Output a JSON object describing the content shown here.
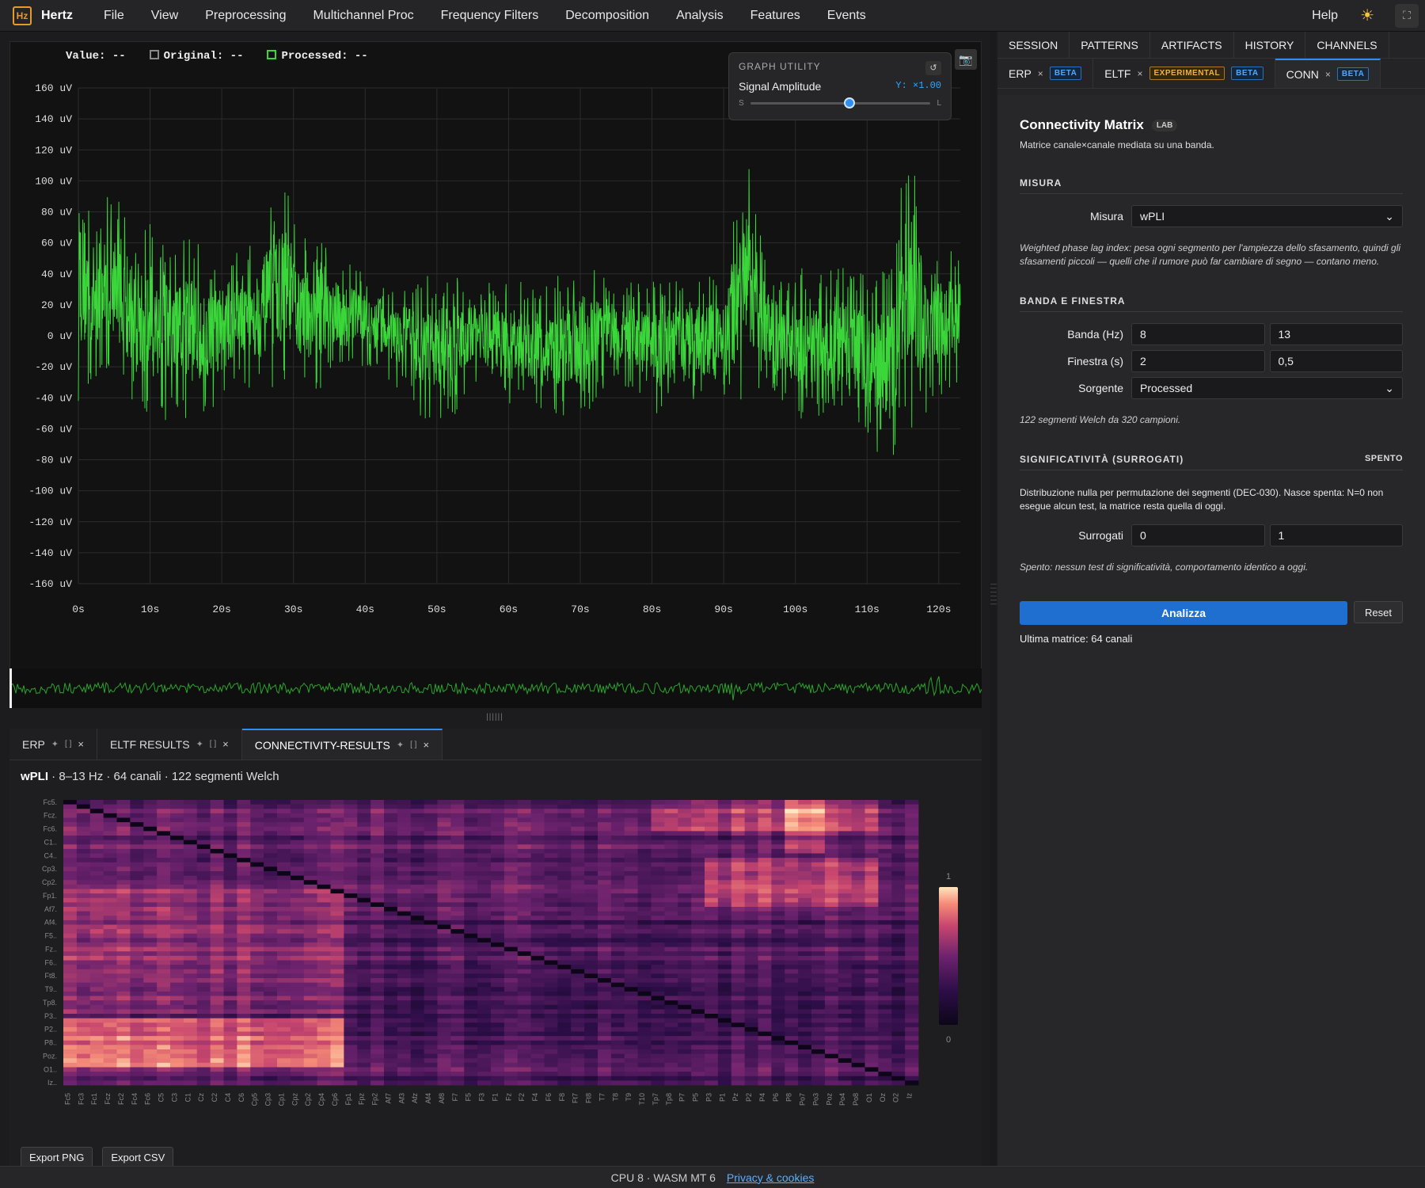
{
  "app": {
    "logo": "Hz",
    "name": "Hertz"
  },
  "menu": [
    "File",
    "View",
    "Preprocessing",
    "Multichannel Proc",
    "Frequency Filters",
    "Decomposition",
    "Analysis",
    "Features",
    "Events"
  ],
  "menu_right": {
    "help": "Help",
    "theme_icon": "sun-icon",
    "fullscreen_icon": "fullscreen-icon"
  },
  "readout": {
    "value_label": "Value:",
    "value": "--",
    "original_label": "Original:",
    "original": "--",
    "processed_label": "Processed:",
    "processed": "--"
  },
  "colors": {
    "signal": "#3ad63a",
    "accent": "#2e8ff0",
    "background": "#121212"
  },
  "graph_utility": {
    "title": "GRAPH UTILITY",
    "reset_icon": "↺",
    "label": "Signal Amplitude",
    "value": "Y: ×1.00",
    "min_label": "S",
    "max_label": "L",
    "slider_fraction": 0.52
  },
  "chart_data": {
    "type": "line",
    "xlabel": "",
    "ylabel": "",
    "xlim": [
      0,
      123
    ],
    "ylim": [
      -160,
      160
    ],
    "x_ticks": [
      "0s",
      "10s",
      "20s",
      "30s",
      "40s",
      "50s",
      "60s",
      "70s",
      "80s",
      "90s",
      "100s",
      "110s",
      "120s"
    ],
    "y_ticks": [
      "160 uV",
      "140 uV",
      "120 uV",
      "100 uV",
      "80 uV",
      "60 uV",
      "40 uV",
      "20 uV",
      "0 uV",
      "-20 uV",
      "-40 uV",
      "-60 uV",
      "-80 uV",
      "-100 uV",
      "-120 uV",
      "-140 uV",
      "-160 uV"
    ],
    "grid": true,
    "series": [
      {
        "values_envelope": [
          [
            0,
            -45,
            130
          ],
          [
            2,
            -35,
            85
          ],
          [
            5,
            -25,
            95
          ],
          [
            8,
            -50,
            60
          ],
          [
            10,
            -60,
            80
          ],
          [
            13,
            -55,
            55
          ],
          [
            15,
            -60,
            70
          ],
          [
            18,
            -50,
            55
          ],
          [
            20,
            -45,
            55
          ],
          [
            23,
            -30,
            60
          ],
          [
            25,
            -40,
            70
          ],
          [
            29,
            -30,
            100
          ],
          [
            31,
            -35,
            60
          ],
          [
            33,
            -40,
            70
          ],
          [
            35,
            -25,
            55
          ],
          [
            40,
            -20,
            40
          ],
          [
            45,
            -35,
            35
          ],
          [
            49,
            -60,
            40
          ],
          [
            52,
            -55,
            40
          ],
          [
            55,
            -30,
            35
          ],
          [
            60,
            -45,
            35
          ],
          [
            65,
            -55,
            35
          ],
          [
            70,
            -55,
            50
          ],
          [
            75,
            -25,
            35
          ],
          [
            80,
            -55,
            35
          ],
          [
            85,
            -40,
            40
          ],
          [
            88,
            -45,
            40
          ],
          [
            90,
            -55,
            45
          ],
          [
            93,
            -40,
            125
          ],
          [
            96,
            -35,
            45
          ],
          [
            100,
            -55,
            45
          ],
          [
            105,
            -50,
            50
          ],
          [
            110,
            -65,
            40
          ],
          [
            113,
            -90,
            45
          ],
          [
            116,
            -60,
            135
          ],
          [
            118,
            -55,
            70
          ],
          [
            120,
            -40,
            60
          ],
          [
            123,
            -30,
            55
          ]
        ]
      }
    ]
  },
  "bottom_tabs": [
    {
      "label": "ERP",
      "pin": "📌",
      "box": "[ ]",
      "close": "×"
    },
    {
      "label": "ELTF RESULTS",
      "pin": "📌",
      "box": "[ ]",
      "close": "×"
    },
    {
      "label": "CONNECTIVITY-RESULTS",
      "pin": "📌",
      "box": "[ ]",
      "close": "×"
    }
  ],
  "heatmap": {
    "title_bold": "wPLI",
    "title_rest": " · 8–13 Hz · 64 canali · 122 segmenti Welch",
    "y_labels": [
      "Fc5.",
      "Fcz.",
      "Fc6.",
      "C1..",
      "C4..",
      "Cp3.",
      "Cp2.",
      "Fp1.",
      "Af7.",
      "Af4.",
      "F5..",
      "Fz..",
      "F6..",
      "Ft8.",
      "T9..",
      "Tp8.",
      "P3..",
      "P2..",
      "P8..",
      "Poz.",
      "O1..",
      "Iz.."
    ],
    "x_labels": [
      "Fc5",
      "Fc3",
      "Fc1",
      "Fcz",
      "Fc2",
      "Fc4",
      "Fc6",
      "C5",
      "C3",
      "C1",
      "Cz",
      "C2",
      "C4",
      "C6",
      "Cp5",
      "Cp3",
      "Cp1",
      "Cpz",
      "Cp2",
      "Cp4",
      "Cp6",
      "Fp1",
      "Fpz",
      "Fp2",
      "Af7",
      "Af3",
      "Afz",
      "Af4",
      "Af8",
      "F7",
      "F5",
      "F3",
      "F1",
      "Fz",
      "F2",
      "F4",
      "F6",
      "F8",
      "Ft7",
      "Ft8",
      "T7",
      "T8",
      "T9",
      "T10",
      "Tp7",
      "Tp8",
      "P7",
      "P5",
      "P3",
      "P1",
      "Pz",
      "P2",
      "P4",
      "P6",
      "P8",
      "Po7",
      "Po3",
      "Poz",
      "Po4",
      "Po8",
      "O1",
      "Oz",
      "O2",
      "Iz"
    ],
    "scale_max": "1",
    "scale_min": "0"
  },
  "exports": {
    "png": "Export PNG",
    "csv": "Export CSV"
  },
  "right_tabs": [
    "SESSION",
    "PATTERNS",
    "ARTIFACTS",
    "HISTORY",
    "CHANNELS"
  ],
  "tool_tabs": [
    {
      "label": "ERP",
      "badges": [
        {
          "text": "BETA",
          "kind": "beta"
        }
      ]
    },
    {
      "label": "ELTF",
      "badges": [
        {
          "text": "EXPERIMENTAL",
          "kind": "exp"
        },
        {
          "text": "BETA",
          "kind": "beta"
        }
      ]
    },
    {
      "label": "CONN",
      "badges": [
        {
          "text": "BETA",
          "kind": "beta"
        }
      ]
    }
  ],
  "conn": {
    "title": "Connectivity Matrix",
    "badge": "LAB",
    "subtitle": "Matrice canale×canale mediata su una banda.",
    "misura_section": "MISURA",
    "misura_label": "Misura",
    "misura_value": "wPLI",
    "misura_desc": "Weighted phase lag index: pesa ogni segmento per l'ampiezza dello sfasamento, quindi gli sfasamenti piccoli — quelli che il rumore può far cambiare di segno — contano meno.",
    "banda_section": "BANDA E FINESTRA",
    "banda_label": "Banda (Hz)",
    "banda_lo": "8",
    "banda_hi": "13",
    "finestra_label": "Finestra (s)",
    "finestra_len": "2",
    "finestra_overlap": "0,5",
    "sorgente_label": "Sorgente",
    "sorgente_value": "Processed",
    "welch_info": "122 segmenti Welch da 320 campioni.",
    "sig_section": "SIGNIFICATIVITÀ (SURROGATI)",
    "sig_state": "SPENTO",
    "sig_desc": "Distribuzione nulla per permutazione dei segmenti (DEC-030). Nasce spenta: N=0 non esegue alcun test, la matrice resta quella di oggi.",
    "surrogati_label": "Surrogati",
    "surrogati_n": "0",
    "surrogati_seed": "1",
    "sig_off_desc": "Spento: nessun test di significatività, comportamento identico a oggi.",
    "analyze": "Analizza",
    "reset": "Reset",
    "last_matrix": "Ultima matrice: 64 canali"
  },
  "footer": {
    "status": "CPU 8 · WASM MT 6",
    "privacy": "Privacy & cookies"
  }
}
